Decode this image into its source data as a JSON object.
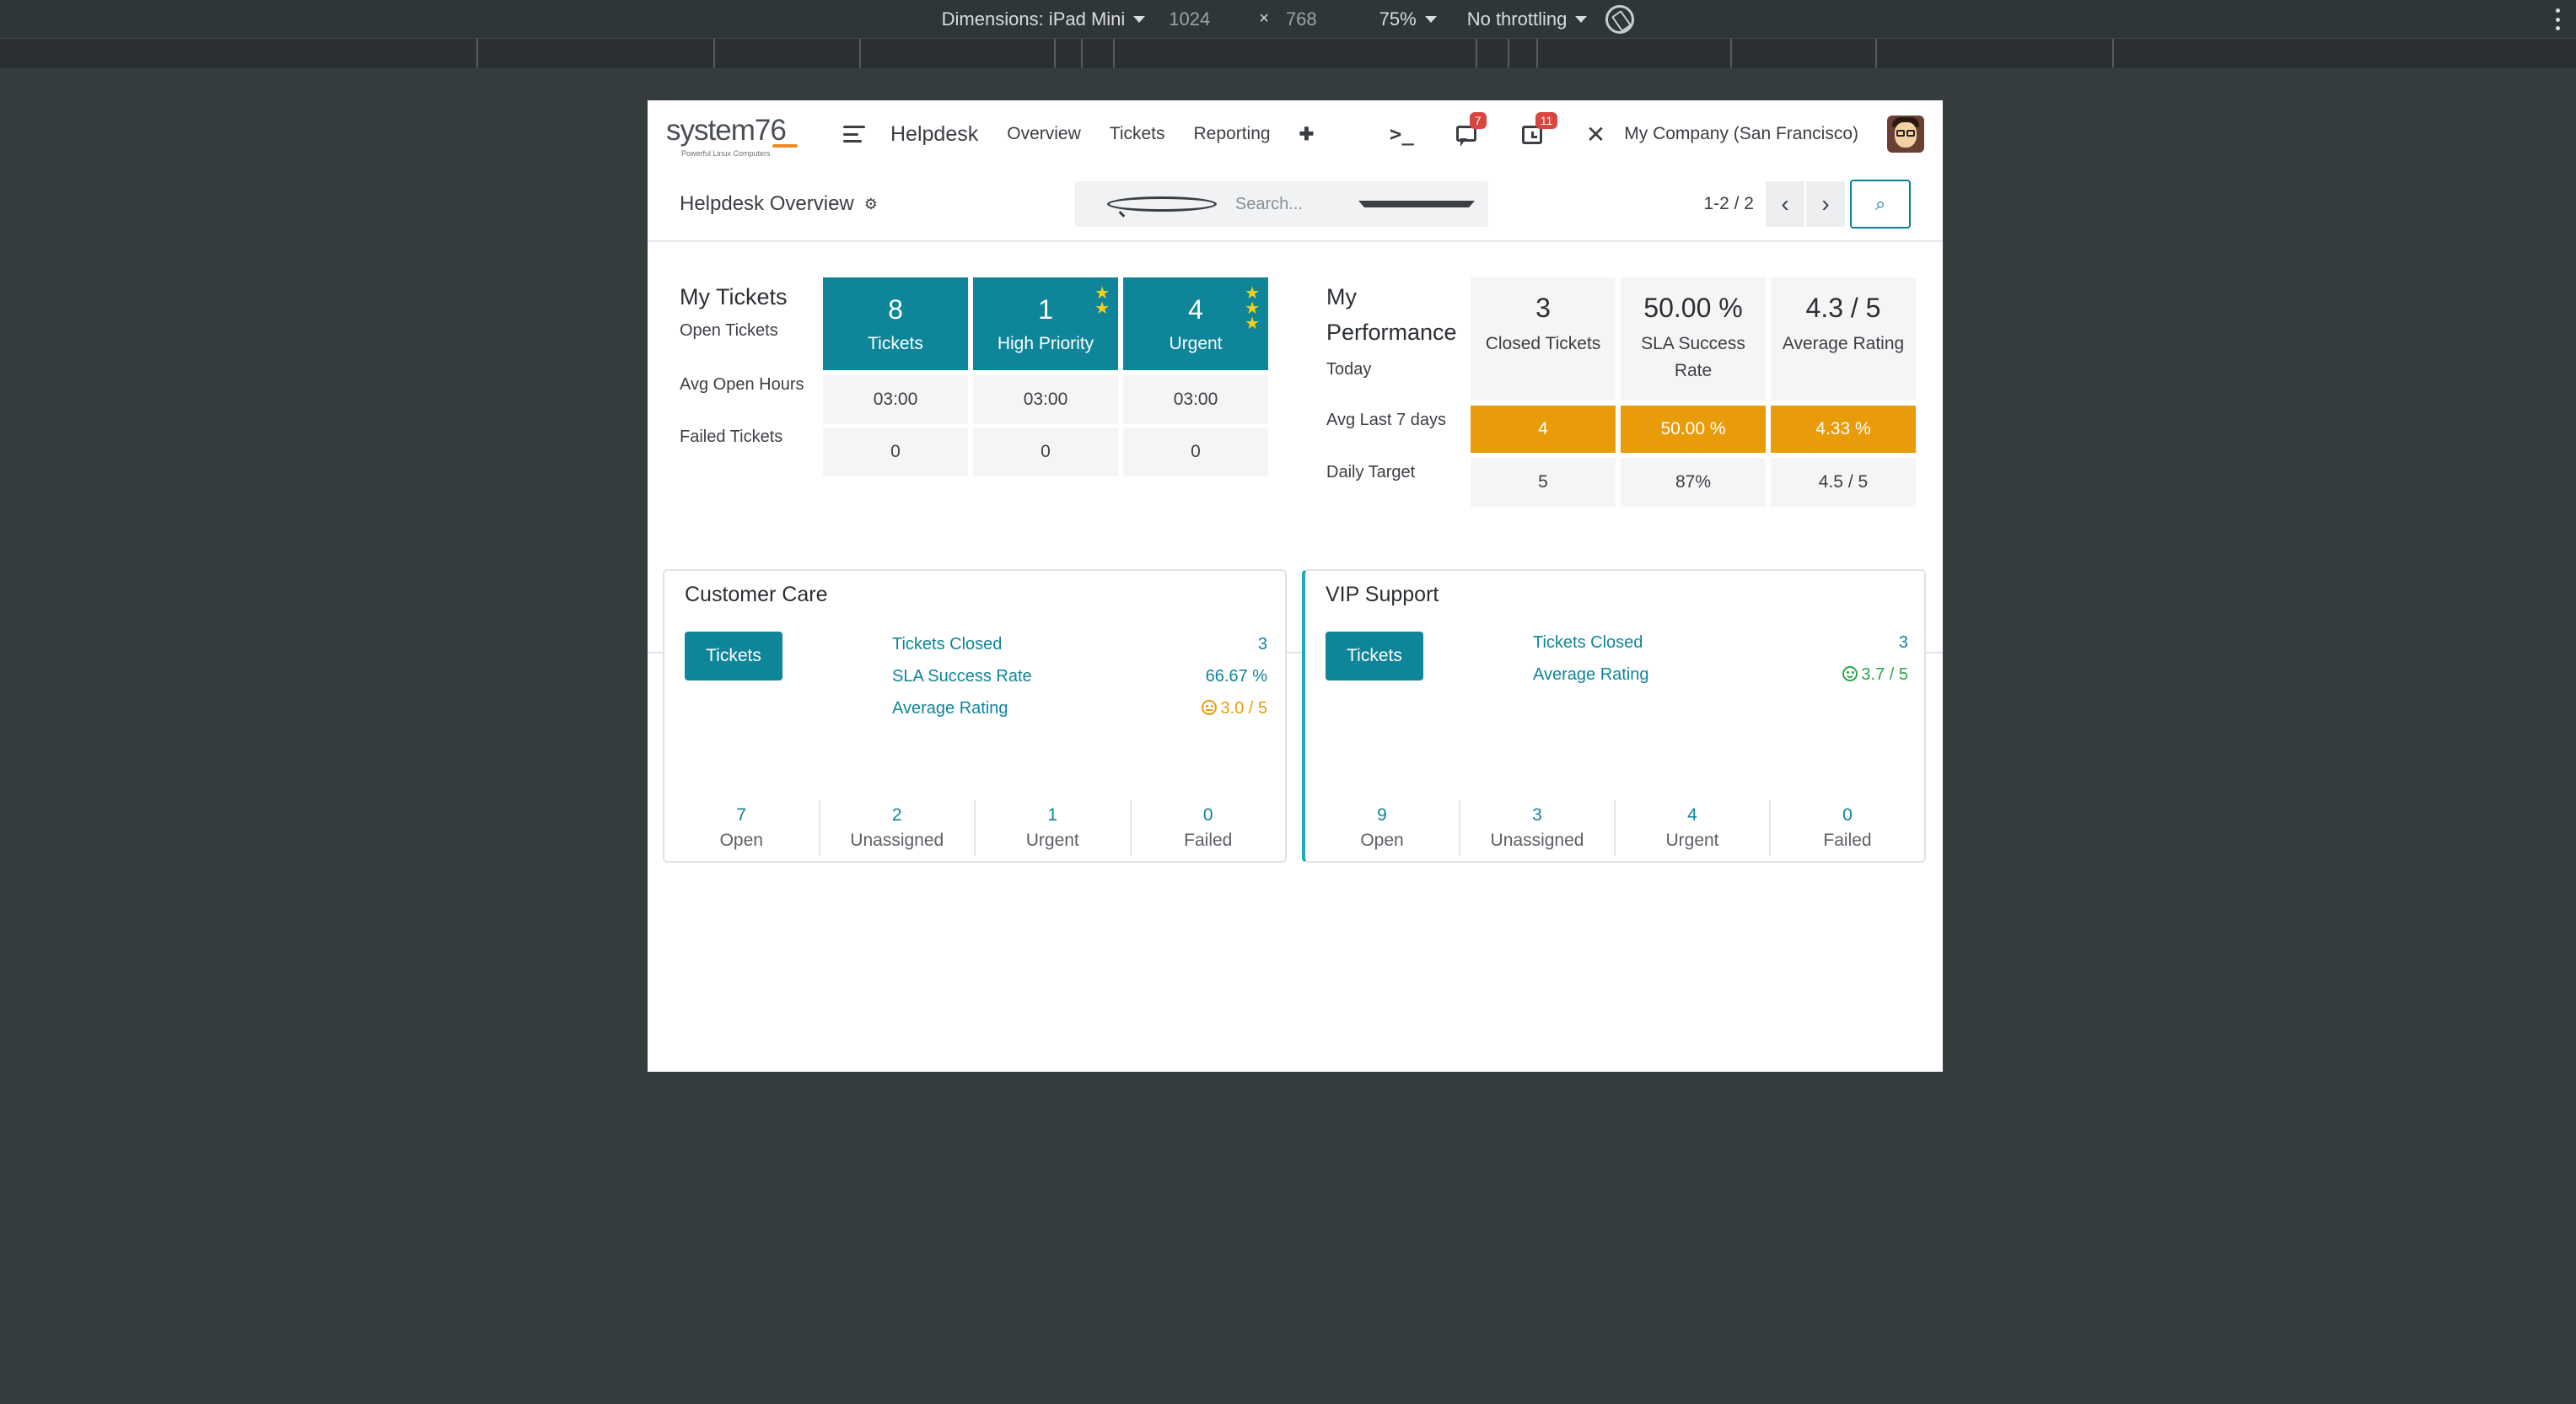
{
  "devtools": {
    "device_label": "Dimensions: iPad Mini",
    "width": "1024",
    "times": "×",
    "height": "768",
    "zoom": "75%",
    "throttle": "No throttling"
  },
  "nav": {
    "logo_text": "system",
    "logo_num": "76",
    "logo_tagline": "Powerful Linux Computers",
    "app_title": "Helpdesk",
    "menu": [
      "Overview",
      "Tickets",
      "Reporting"
    ],
    "plus": "✚",
    "terminal": ">_",
    "messages_badge": "7",
    "activities_badge": "11",
    "tools": "✕",
    "company": "My Company (San Francisco)"
  },
  "control": {
    "breadcrumb": "Helpdesk Overview",
    "search_placeholder": "Search...",
    "pager": "1-2 / 2",
    "prev": "‹",
    "next": "›"
  },
  "my_tickets": {
    "title": "My Tickets",
    "row_labels": [
      "Open Tickets",
      "Avg Open Hours",
      "Failed Tickets"
    ],
    "columns": [
      {
        "value": "8",
        "label": "Tickets",
        "stars": 0,
        "avg_hours": "03:00",
        "failed": "0"
      },
      {
        "value": "1",
        "label": "High Priority",
        "stars": 2,
        "avg_hours": "03:00",
        "failed": "0"
      },
      {
        "value": "4",
        "label": "Urgent",
        "stars": 3,
        "avg_hours": "03:00",
        "failed": "0"
      }
    ]
  },
  "performance": {
    "title_line1": "My",
    "title_line2": "Performance",
    "row_labels": [
      "Today",
      "Avg Last 7 days",
      "Daily Target"
    ],
    "columns": [
      {
        "value": "3",
        "label": "Closed Tickets",
        "avg7": "4",
        "target": "5"
      },
      {
        "value": "50.00 %",
        "label": "SLA Success Rate",
        "avg7": "50.00 %",
        "target": "87%"
      },
      {
        "value": "4.3 / 5",
        "label": "Average Rating",
        "avg7": "4.33 %",
        "target": "4.5 / 5"
      }
    ]
  },
  "teams": [
    {
      "name": "Customer Care",
      "button": "Tickets",
      "stats": [
        {
          "label": "Tickets Closed",
          "value": "3"
        },
        {
          "label": "SLA Success Rate",
          "value": "66.67 %"
        },
        {
          "label": "Average Rating",
          "value": "3.0 / 5"
        }
      ],
      "footer": [
        {
          "count": "7",
          "label": "Open"
        },
        {
          "count": "2",
          "label": "Unassigned"
        },
        {
          "count": "1",
          "label": "Urgent"
        },
        {
          "count": "0",
          "label": "Failed"
        }
      ]
    },
    {
      "name": "VIP Support",
      "button": "Tickets",
      "stats": [
        {
          "label": "Tickets Closed",
          "value": "3"
        },
        {
          "label": "Average Rating",
          "value": "3.7 / 5"
        }
      ],
      "footer": [
        {
          "count": "9",
          "label": "Open"
        },
        {
          "count": "3",
          "label": "Unassigned"
        },
        {
          "count": "4",
          "label": "Urgent"
        },
        {
          "count": "0",
          "label": "Failed"
        }
      ]
    }
  ],
  "colors": {
    "accent": "#0f8599",
    "orange": "#e89c0a",
    "badge": "#d9453f",
    "rating_meh": "#e89c0a",
    "rating_good": "#28a745"
  }
}
